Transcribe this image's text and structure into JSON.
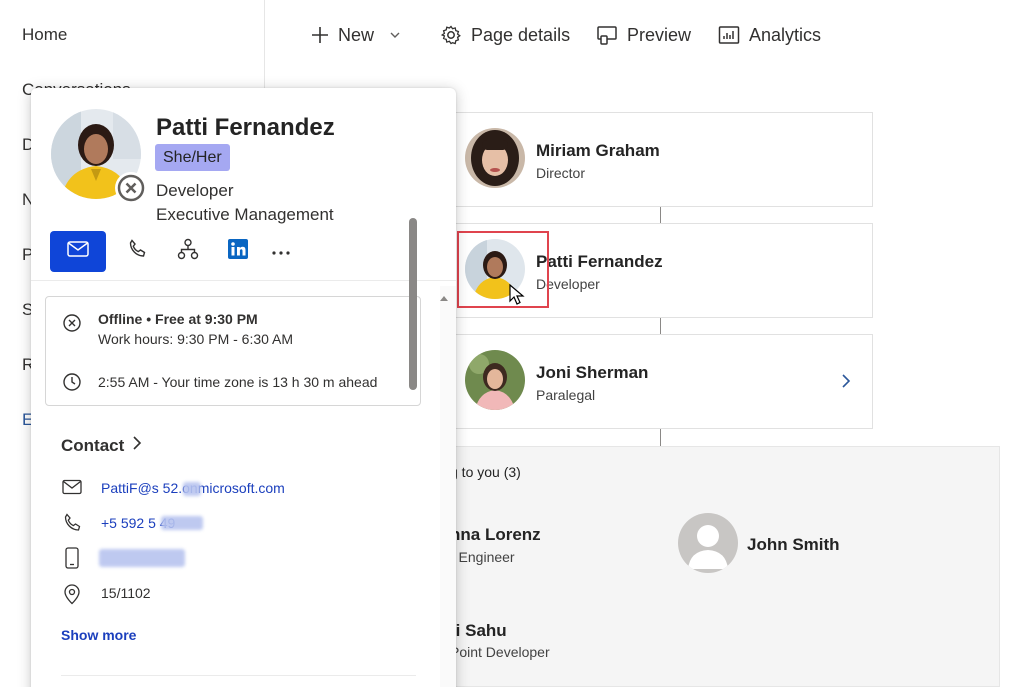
{
  "left_nav": {
    "items": [
      "Home",
      "Conversations",
      "D",
      "N",
      "P",
      "S",
      "R",
      "E"
    ]
  },
  "toolbar": {
    "new_label": "New",
    "page_details_label": "Page details",
    "preview_label": "Preview",
    "analytics_label": "Analytics"
  },
  "org_chart": {
    "manager": {
      "name": "Miriam Graham",
      "title": "Director"
    },
    "selected": {
      "name": "Patti Fernandez",
      "title": "Developer"
    },
    "peer": {
      "name": "Joni Sherman",
      "title": "Paralegal"
    }
  },
  "reports": {
    "header": "g to you (3)",
    "people": [
      {
        "name": "nna Lorenz",
        "title": "r Engineer"
      },
      {
        "name": "John Smith",
        "title": ""
      },
      {
        "name": "ti Sahu",
        "title": "Point Developer"
      }
    ]
  },
  "persona_card": {
    "name": "Patti Fernandez",
    "pronouns": "She/Her",
    "job_title": "Developer",
    "department": "Executive Management",
    "availability": {
      "status": "Offline • Free at 9:30 PM",
      "work_hours": "Work hours: 9:30 PM - 6:30 AM",
      "time_zone": "2:55 AM - Your time zone is 13 h 30 m ahead"
    },
    "contact": {
      "heading": "Contact",
      "email": "PattiF@s   52.onmicrosoft.com",
      "phone": "+5 592 5        49",
      "location": "15/1102",
      "show_more": "Show more"
    }
  },
  "colors": {
    "accent": "#0f45d8",
    "pronoun_badge": "#a5a8f2",
    "link": "#1b3fbd",
    "highlight": "#e0444e"
  }
}
